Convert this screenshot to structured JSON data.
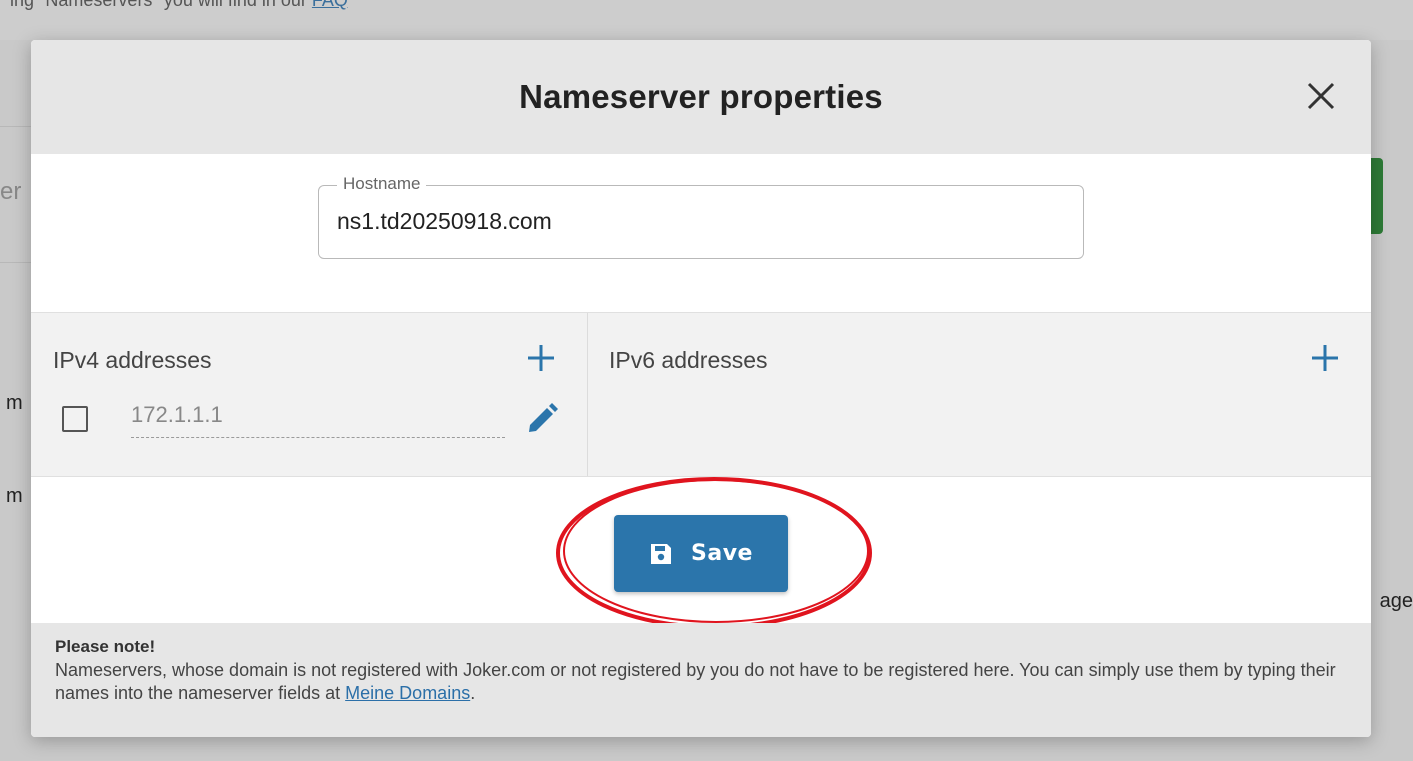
{
  "background": {
    "top_text": "ing \"Nameservers\" you will find in our",
    "top_link": "FAQ",
    "left_fragment_1": "er",
    "left_fragment_2": "m",
    "left_fragment_3": "m",
    "right_fragment": "age"
  },
  "modal": {
    "title": "Nameserver properties",
    "close_label": "×",
    "hostname": {
      "label": "Hostname",
      "value": "ns1.td20250918.com"
    },
    "ipv4": {
      "heading": "IPv4 addresses",
      "entries": [
        "172.1.1.1"
      ]
    },
    "ipv6": {
      "heading": "IPv6 addresses"
    },
    "save_label": "Save",
    "note": {
      "title": "Please note!",
      "text": "Nameservers, whose domain is not registered with Joker.com or not registered by you do not have to be registered here. You can simply use them by typing their names into the nameserver fields at ",
      "link": "Meine Domains",
      "suffix": "."
    }
  },
  "colors": {
    "accent": "#2b75ab",
    "highlight": "#e0141e",
    "header_bg": "#e6e6e6"
  },
  "icons": [
    "close-icon",
    "plus-icon",
    "checkbox-icon",
    "pencil-icon",
    "floppy-disk-icon"
  ]
}
